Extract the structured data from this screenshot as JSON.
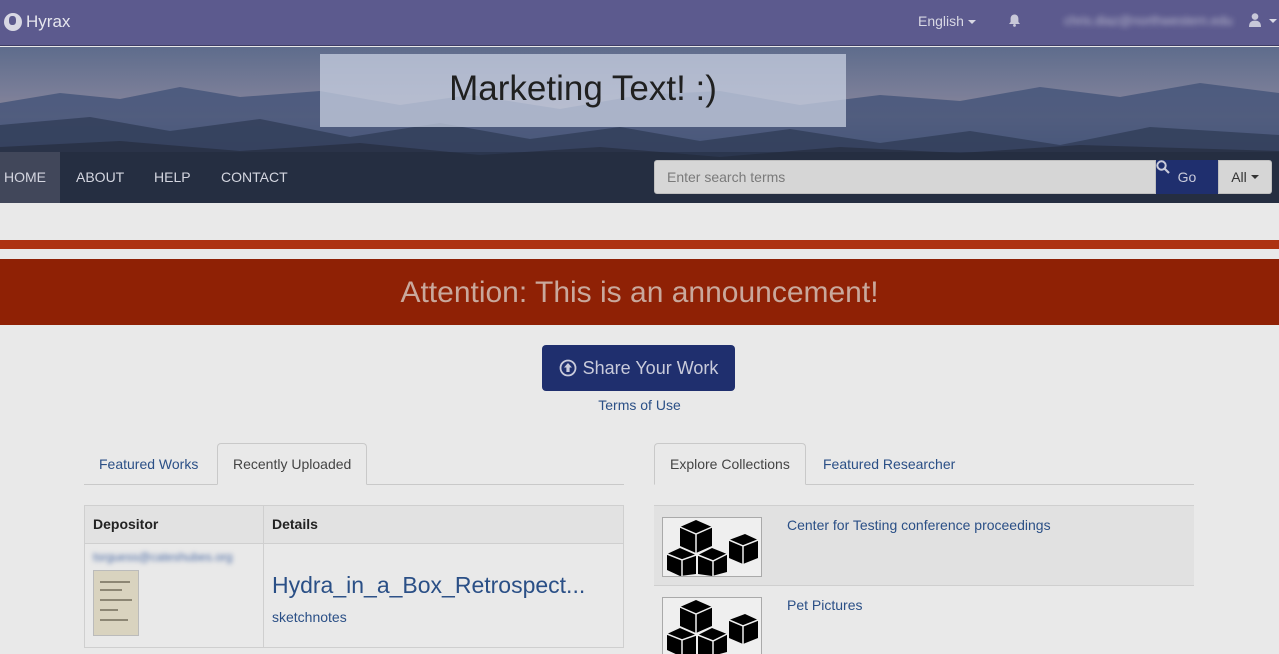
{
  "topbar": {
    "brand": "Hyrax",
    "language": "English",
    "user_email": "chris.diaz@northwestern.edu"
  },
  "hero": {
    "marketing_text": "Marketing Text! :)"
  },
  "nav": {
    "items": [
      {
        "label": "HOME"
      },
      {
        "label": "ABOUT"
      },
      {
        "label": "HELP"
      },
      {
        "label": "CONTACT"
      }
    ]
  },
  "search": {
    "placeholder": "Enter search terms",
    "go_label": "Go",
    "scope_label": "All"
  },
  "announcement": {
    "text": "Attention: This is an announcement!",
    "color": "#8f2105"
  },
  "share": {
    "button_label": "Share Your Work",
    "terms_label": "Terms of Use"
  },
  "left_tabs": {
    "items": [
      {
        "label": "Featured Works"
      },
      {
        "label": "Recently Uploaded"
      }
    ],
    "active": "Recently Uploaded"
  },
  "right_tabs": {
    "items": [
      {
        "label": "Explore Collections"
      },
      {
        "label": "Featured Researcher"
      }
    ],
    "active": "Explore Collections"
  },
  "recent_table": {
    "headers": [
      "Depositor",
      "Details"
    ],
    "rows": [
      {
        "depositor": "tsrguess@cateshubes.org",
        "title": "Hydra_in_a_Box_Retrospect...",
        "keyword": "sketchnotes"
      }
    ]
  },
  "collections": [
    {
      "title": "Center for Testing conference proceedings"
    },
    {
      "title": "Pet Pictures"
    }
  ],
  "colors": {
    "navbar": "#5c5a8e",
    "primary_button": "#1f2f6e",
    "link": "#2a4f86"
  }
}
